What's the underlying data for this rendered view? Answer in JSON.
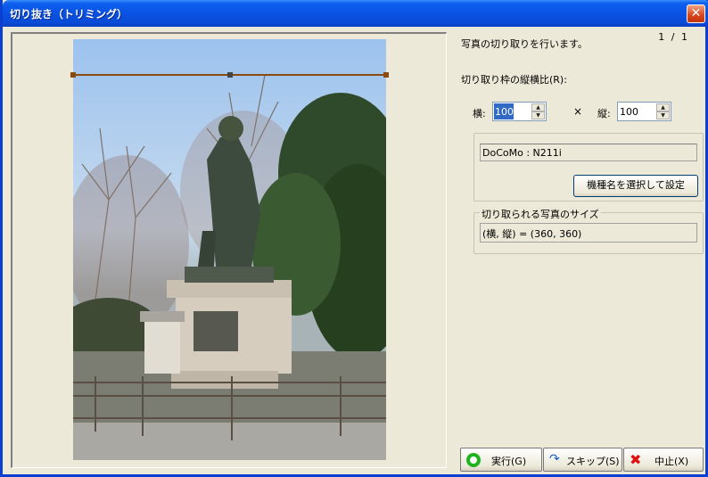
{
  "window": {
    "title": "切り抜き（トリミング）",
    "close_glyph": "✕"
  },
  "page_count": "1 / 1",
  "description": "写真の切り取りを行います。",
  "ratio": {
    "label": "切り取り枠の縦横比(R):",
    "width_label": "横:",
    "width_value": "100",
    "times": "×",
    "height_label": "縦:",
    "height_value": "100"
  },
  "device": {
    "name": "DoCoMo : N211i",
    "select_button": "機種名を選択して設定"
  },
  "crop_size": {
    "group_title": "切り取られる写真のサイズ",
    "value": "(横, 縦) = (360, 360)"
  },
  "buttons": {
    "run": "実行(G)",
    "skip": "スキップ(S)",
    "stop": "中止(X)"
  },
  "icons": {
    "run": "green-circle-icon",
    "skip": "skip-arrow-icon",
    "stop": "red-x-icon"
  },
  "colors": {
    "titlebar": "#0a52e3",
    "crop_line": "#8a4a10",
    "background": "#ece9d8"
  }
}
